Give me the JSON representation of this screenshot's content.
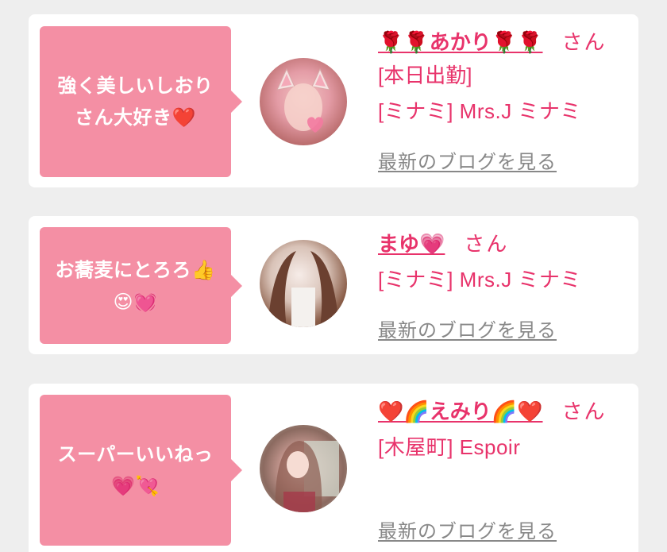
{
  "cards": [
    {
      "bubble_line1": "強く美しいしおり",
      "bubble_line2": "さん大好き❤️",
      "name": "🌹🌹あかり🌹🌹",
      "suffix": "さん",
      "status": "[本日出勤]",
      "shop": "[ミナミ] Mrs.J ミナミ",
      "blog_link": "最新のブログを見る",
      "avatar_icon": "avatar-photo"
    },
    {
      "bubble_line1": "お蕎麦にとろろ👍",
      "bubble_line2": "😍💓",
      "name": "まゆ💗",
      "suffix": "さん",
      "status": "",
      "shop": "[ミナミ] Mrs.J ミナミ",
      "blog_link": "最新のブログを見る",
      "avatar_icon": "avatar-photo"
    },
    {
      "bubble_line1": "スーパーいいねっ",
      "bubble_line2": "💗💘",
      "name": "❤️🌈えみり🌈❤️",
      "suffix": "さん",
      "status": "",
      "shop": "[木屋町] Espoir",
      "blog_link": "最新のブログを見る",
      "avatar_icon": "avatar-photo"
    }
  ],
  "colors": {
    "page_bg": "#eeeeee",
    "card_bg": "#ffffff",
    "bubble_bg": "#f48fa4",
    "accent": "#e8336b",
    "link_gray": "#888888"
  }
}
